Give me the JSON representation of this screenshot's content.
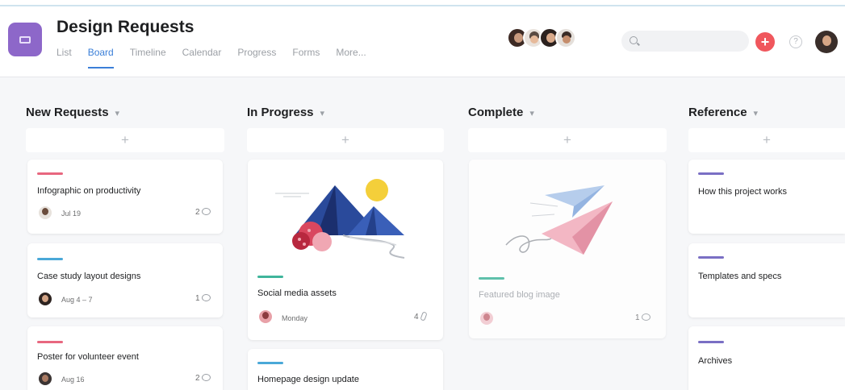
{
  "project": {
    "title": "Design Requests",
    "tabs": [
      "List",
      "Board",
      "Timeline",
      "Calendar",
      "Progress",
      "Forms",
      "More..."
    ],
    "active_tab": "Board"
  },
  "header": {
    "search_placeholder": "",
    "add_label": "+",
    "help_label": "?"
  },
  "columns": [
    {
      "title": "New Requests",
      "cards": [
        {
          "title": "Infographic on productivity",
          "date": "Jul 19",
          "comments": "2",
          "bar_color": "#e8677f"
        },
        {
          "title": "Case study layout designs",
          "date": "Aug 4 – 7",
          "comments": "1",
          "bar_color": "#4aa8d8"
        },
        {
          "title": "Poster for volunteer event",
          "date": "Aug 16",
          "comments": "2",
          "bar_color": "#e8677f"
        }
      ]
    },
    {
      "title": "In Progress",
      "cards": [
        {
          "title": "Social media assets",
          "date": "Monday",
          "attachments": "4",
          "bar_color": "#3fb59b"
        },
        {
          "title": "Homepage design update",
          "bar_color": "#4aa8d8"
        }
      ]
    },
    {
      "title": "Complete",
      "cards": [
        {
          "title": "Featured blog image",
          "comments": "1",
          "bar_color": "#3fb59b"
        }
      ]
    },
    {
      "title": "Reference",
      "cards": [
        {
          "title": "How this project works",
          "bar_color": "#7a6fc4"
        },
        {
          "title": "Templates and specs",
          "bar_color": "#7a6fc4"
        },
        {
          "title": "Archives",
          "bar_color": "#7a6fc4"
        }
      ]
    }
  ],
  "colors": {
    "accent": "#3b7fd8",
    "project_icon": "#8d67c9",
    "add_button": "#f0575d"
  }
}
